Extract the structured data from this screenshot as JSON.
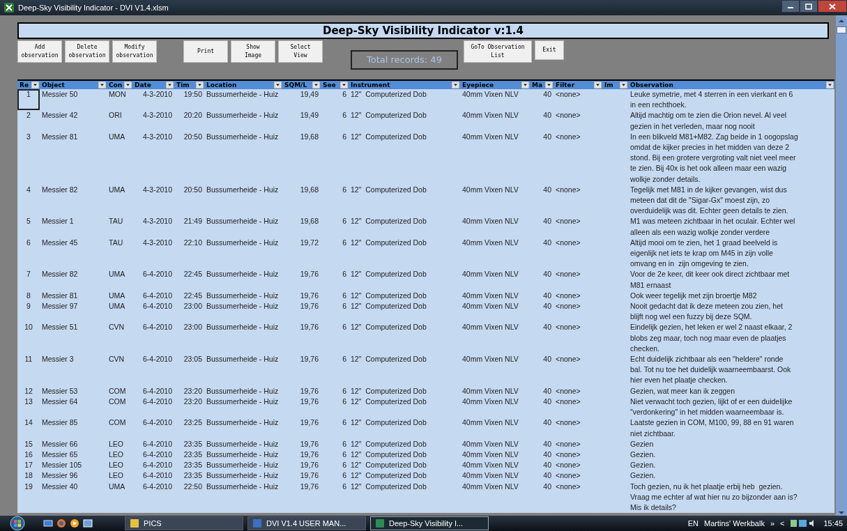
{
  "window": {
    "title": "Deep-Sky Visibility Indicator - DVI V1.4.xlsm"
  },
  "banner": "Deep-Sky Visibility Indicator v:1.4",
  "buttons_left": [
    {
      "label": "Add\nobservation"
    },
    {
      "label": "Delete\nobservation"
    },
    {
      "label": "Modify\nobservation"
    }
  ],
  "buttons_mid": [
    {
      "label": "Print"
    },
    {
      "label": "Show\nImage"
    },
    {
      "label": "Select\nView"
    }
  ],
  "total_records": "Total records: 49",
  "buttons_right": [
    {
      "label": "GoTo Observation\nList"
    },
    {
      "label": "Exit"
    }
  ],
  "table": {
    "columns": [
      "Re",
      "Object",
      "Con",
      "Date",
      "Tim",
      "Location",
      "SQM/L",
      "See",
      "Instrument",
      "Eyepiece",
      "Ma",
      "Filter",
      "Im",
      "Observation"
    ],
    "rows": [
      {
        "selected": true,
        "cells": [
          "1",
          "Messier 50",
          "MON",
          "4-3-2010",
          "19:50",
          "Bussumerheide - Huiz",
          "19,49",
          "6",
          "12\"  Computerized Dob",
          "40mm Vixen NLV",
          "40",
          "<none>",
          "",
          "Leuke symetrie, met 4 sterren in een vierkant en 6\nin een rechthoek."
        ]
      },
      {
        "selected": false,
        "cells": [
          "2",
          "Messier 42",
          "ORI",
          "4-3-2010",
          "20:20",
          "Bussumerheide - Huiz",
          "19,49",
          "6",
          "12\"  Computerized Dob",
          "40mm Vixen NLV",
          "40",
          "<none>",
          "",
          "Altijd machtig om te zien die Orion nevel. Al veel\ngezien in het verleden, maar nog nooit"
        ]
      },
      {
        "selected": false,
        "cells": [
          "3",
          "Messier 81",
          "UMA",
          "4-3-2010",
          "20:50",
          "Bussumerheide - Huiz",
          "19,68",
          "6",
          "12\"  Computerized Dob",
          "40mm Vixen NLV",
          "40",
          "<none>",
          "",
          "In een blikveld M81+M82. Zag beide in 1 oogopslag\nomdat de kijker precies in het midden van deze 2\nstond. Bij een grotere vergroting valt niet veel meer\nte zien. Bij 40x is het ook alleen maar een wazig\nwolkje zonder details."
        ]
      },
      {
        "selected": false,
        "cells": [
          "4",
          "Messier 82",
          "UMA",
          "4-3-2010",
          "20:50",
          "Bussumerheide - Huiz",
          "19,68",
          "6",
          "12\"  Computerized Dob",
          "40mm Vixen NLV",
          "40",
          "<none>",
          "",
          "Tegelijk met M81 in de kijker gevangen, wist dus\nmeteen dat dit de \"Sigar-Gx\" moest zijn, zo\noverduidelijk was dit. Echter geen details te zien."
        ]
      },
      {
        "selected": false,
        "cells": [
          "5",
          "Messier 1",
          "TAU",
          "4-3-2010",
          "21:49",
          "Bussumerheide - Huiz",
          "19,68",
          "6",
          "12\"  Computerized Dob",
          "40mm Vixen NLV",
          "40",
          "<none>",
          "",
          "M1 was meteen zichtbaar in het oculair. Echter wel\nalleen als een wazig wolkje zonder verdere"
        ]
      },
      {
        "selected": false,
        "cells": [
          "6",
          "Messier 45",
          "TAU",
          "4-3-2010",
          "22:10",
          "Bussumerheide - Huiz",
          "19,72",
          "6",
          "12\"  Computerized Dob",
          "40mm Vixen NLV",
          "40",
          "<none>",
          "",
          "Altijd mooi om te zien, het 1 graad beelveld is\neigenlijk net iets te krap om M45 in zijn volle\nomvang en in  zijn omgeving te zien."
        ]
      },
      {
        "selected": false,
        "cells": [
          "7",
          "Messier 82",
          "UMA",
          "6-4-2010",
          "22:45",
          "Bussumerheide - Huiz",
          "19,76",
          "6",
          "12\"  Computerized Dob",
          "40mm Vixen NLV",
          "40",
          "<none>",
          "",
          "Voor de 2e keer, dit keer ook direct zichtbaar met\nM81 ernaast"
        ]
      },
      {
        "selected": false,
        "cells": [
          "8",
          "Messier 81",
          "UMA",
          "6-4-2010",
          "22:45",
          "Bussumerheide - Huiz",
          "19,76",
          "6",
          "12\"  Computerized Dob",
          "40mm Vixen NLV",
          "40",
          "<none>",
          "",
          "Ook weer tegelijk met zijn broertje M82"
        ]
      },
      {
        "selected": false,
        "cells": [
          "9",
          "Messier 97",
          "UMA",
          "6-4-2010",
          "23:00",
          "Bussumerheide - Huiz",
          "19,76",
          "6",
          "12\"  Computerized Dob",
          "40mm Vixen NLV",
          "40",
          "<none>",
          "",
          "Nooit gedacht dat ik deze meteen zou zien, het\nblijft nog wel een fuzzy bij deze SQM."
        ]
      },
      {
        "selected": false,
        "cells": [
          "10",
          "Messier 51",
          "CVN",
          "6-4-2010",
          "23:00",
          "Bussumerheide - Huiz",
          "19,76",
          "6",
          "12\"  Computerized Dob",
          "40mm Vixen NLV",
          "40",
          "<none>",
          "",
          "Eindelijk gezien, het leken er wel 2 naast elkaar, 2\nblobs zeg maar, toch nog maar even de plaatjes\nchecken."
        ]
      },
      {
        "selected": false,
        "cells": [
          "11",
          "Messier 3",
          "CVN",
          "6-4-2010",
          "23:05",
          "Bussumerheide - Huiz",
          "19,76",
          "6",
          "12\"  Computerized Dob",
          "40mm Vixen NLV",
          "40",
          "<none>",
          "",
          "Echt duidelijk zichtbaar als een \"heldere\" ronde\nbal. Tot nu toe het duidelijk waarneembaarst. Ook\nhier even het plaatje checken."
        ]
      },
      {
        "selected": false,
        "cells": [
          "12",
          "Messier 53",
          "COM",
          "6-4-2010",
          "23:20",
          "Bussumerheide - Huiz",
          "19,76",
          "6",
          "12\"  Computerized Dob",
          "40mm Vixen NLV",
          "40",
          "<none>",
          "",
          "Gezien, wat meer kan ik zeggen"
        ]
      },
      {
        "selected": false,
        "cells": [
          "13",
          "Messier 64",
          "COM",
          "6-4-2010",
          "23:20",
          "Bussumerheide - Huiz",
          "19,76",
          "6",
          "12\"  Computerized Dob",
          "40mm Vixen NLV",
          "40",
          "<none>",
          "",
          "Niet verwacht toch gezien, lijkt of er een duidelijke\n\"verdonkering\" in het midden waarneembaar is."
        ]
      },
      {
        "selected": false,
        "cells": [
          "14",
          "Messier 85",
          "COM",
          "6-4-2010",
          "23:25",
          "Bussumerheide - Huiz",
          "19,76",
          "6",
          "12\"  Computerized Dob",
          "40mm Vixen NLV",
          "40",
          "<none>",
          "",
          "Laatste gezien in COM, M100, 99, 88 en 91 waren\nniet zichtbaar."
        ]
      },
      {
        "selected": false,
        "cells": [
          "15",
          "Messier 66",
          "LEO",
          "6-4-2010",
          "23:35",
          "Bussumerheide - Huiz",
          "19,76",
          "6",
          "12\"  Computerized Dob",
          "40mm Vixen NLV",
          "40",
          "<none>",
          "",
          "Gezien"
        ]
      },
      {
        "selected": false,
        "cells": [
          "16",
          "Messier 65",
          "LEO",
          "6-4-2010",
          "23:35",
          "Bussumerheide - Huiz",
          "19,76",
          "6",
          "12\"  Computerized Dob",
          "40mm Vixen NLV",
          "40",
          "<none>",
          "",
          "Gezien."
        ]
      },
      {
        "selected": false,
        "cells": [
          "17",
          "Messier 105",
          "LEO",
          "6-4-2010",
          "23:35",
          "Bussumerheide - Huiz",
          "19,76",
          "6",
          "12\"  Computerized Dob",
          "40mm Vixen NLV",
          "40",
          "<none>",
          "",
          "Gezien."
        ]
      },
      {
        "selected": false,
        "cells": [
          "18",
          "Messier 96",
          "LEO",
          "6-4-2010",
          "23:35",
          "Bussumerheide - Huiz",
          "19,76",
          "6",
          "12\"  Computerized Dob",
          "40mm Vixen NLV",
          "40",
          "<none>",
          "",
          "Gezien."
        ]
      },
      {
        "selected": false,
        "cells": [
          "19",
          "Messier 40",
          "UMA",
          "6-4-2010",
          "22:50",
          "Bussumerheide - Huiz",
          "19,76",
          "6",
          "12\"  Computerized Dob",
          "40mm Vixen NLV",
          "40",
          "<none>",
          "",
          "Toch gezien, nu ik het plaatje erbij heb  gezien.\nVraag me echter af wat hier nu zo bijzonder aan is?\nMis ik details?"
        ]
      }
    ]
  },
  "taskbar": {
    "tasks": [
      {
        "label": "PICS",
        "selected": false
      },
      {
        "label": "DVI V1.4 USER MAN...",
        "selected": false
      },
      {
        "label": "Deep-Sky Visibility I...",
        "selected": true
      }
    ],
    "language": "EN",
    "toolbar": "Martins' Werkbalk",
    "chevron": "»",
    "arrow": "<",
    "clock": "15:45"
  }
}
